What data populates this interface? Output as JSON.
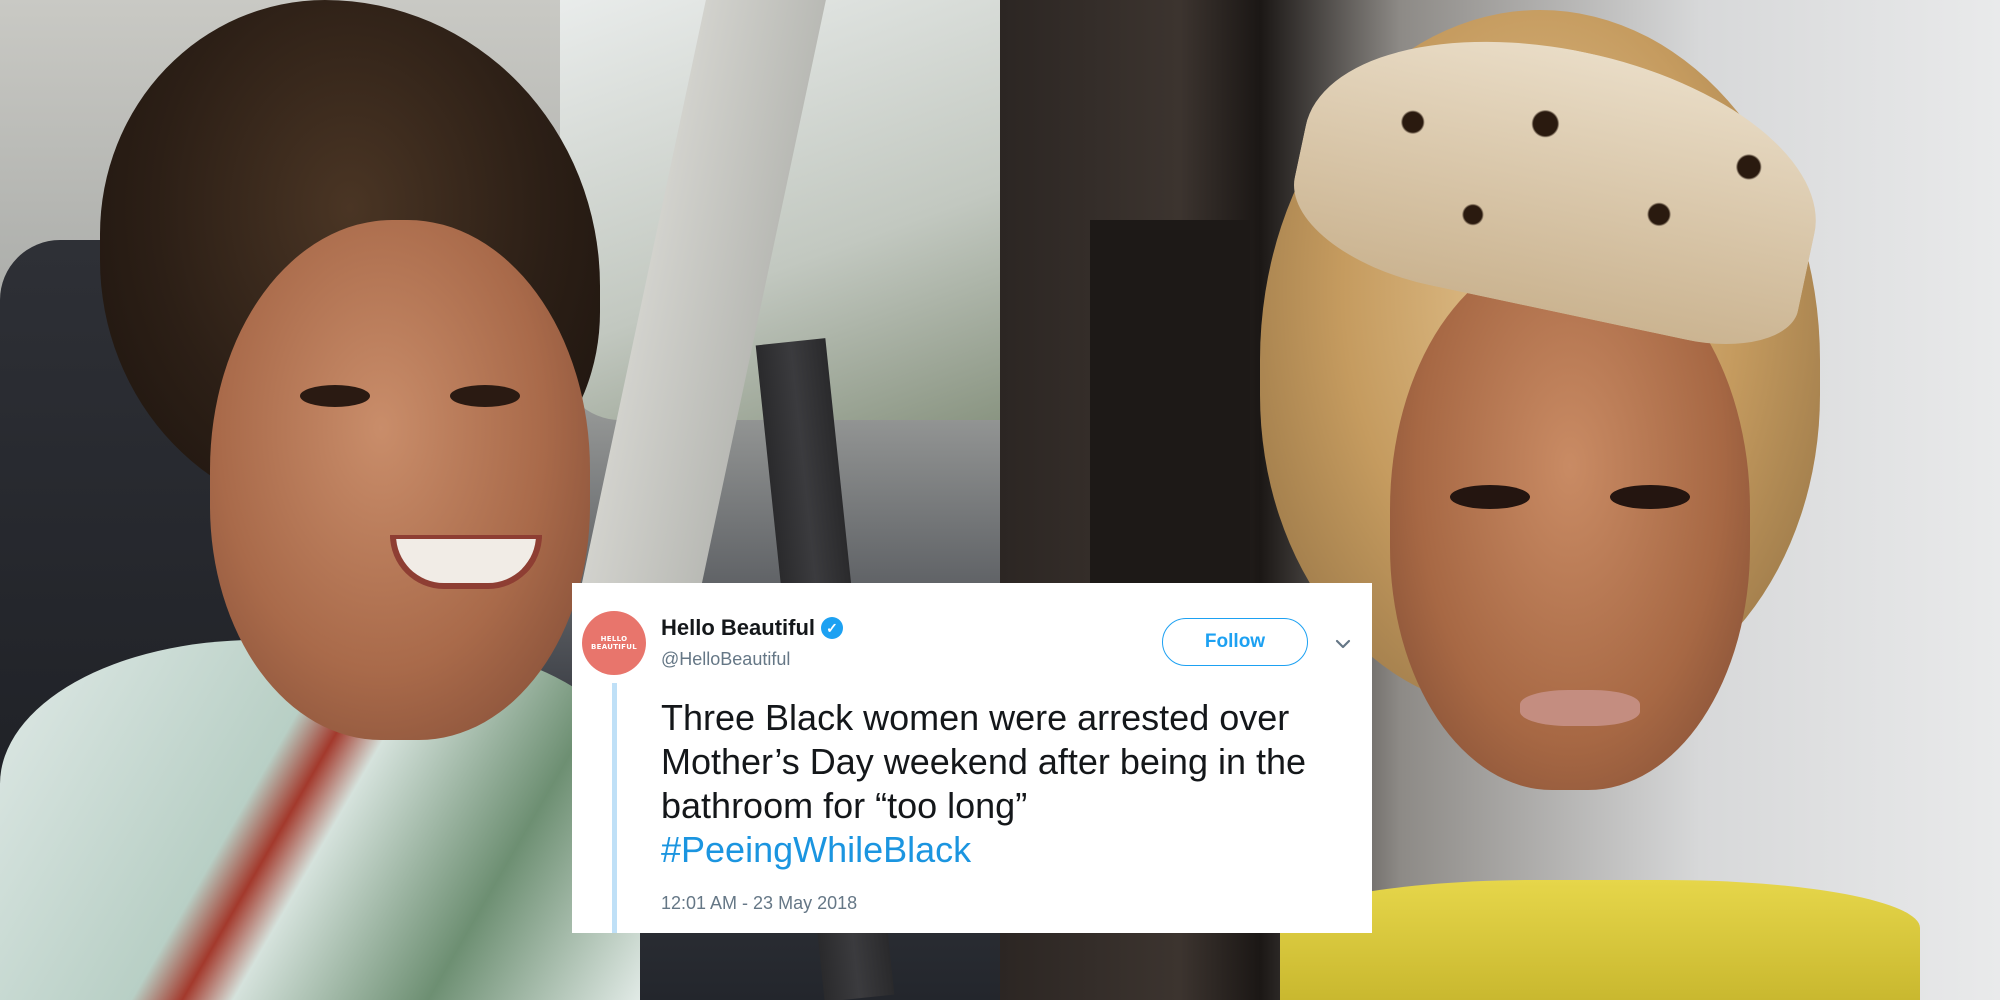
{
  "tweet": {
    "avatar_text": "HELLO BEAUTIFUL",
    "display_name": "Hello Beautiful",
    "handle": "@HelloBeautiful",
    "follow_label": "Follow",
    "verified_icon": "verified-badge-icon",
    "menu_icon": "chevron-down-icon",
    "text_lines": [
      "Three Black women were arrested over",
      "Mother’s Day weekend after being in the",
      "bathroom for “too long”"
    ],
    "hashtag": "#PeeingWhileBlack",
    "timestamp": "12:01 AM - 23 May 2018",
    "colors": {
      "accent": "#1da1f2",
      "hashtag": "#1b95e0",
      "avatar": "#e8756c",
      "thread_line": "#bfe0f7"
    }
  }
}
